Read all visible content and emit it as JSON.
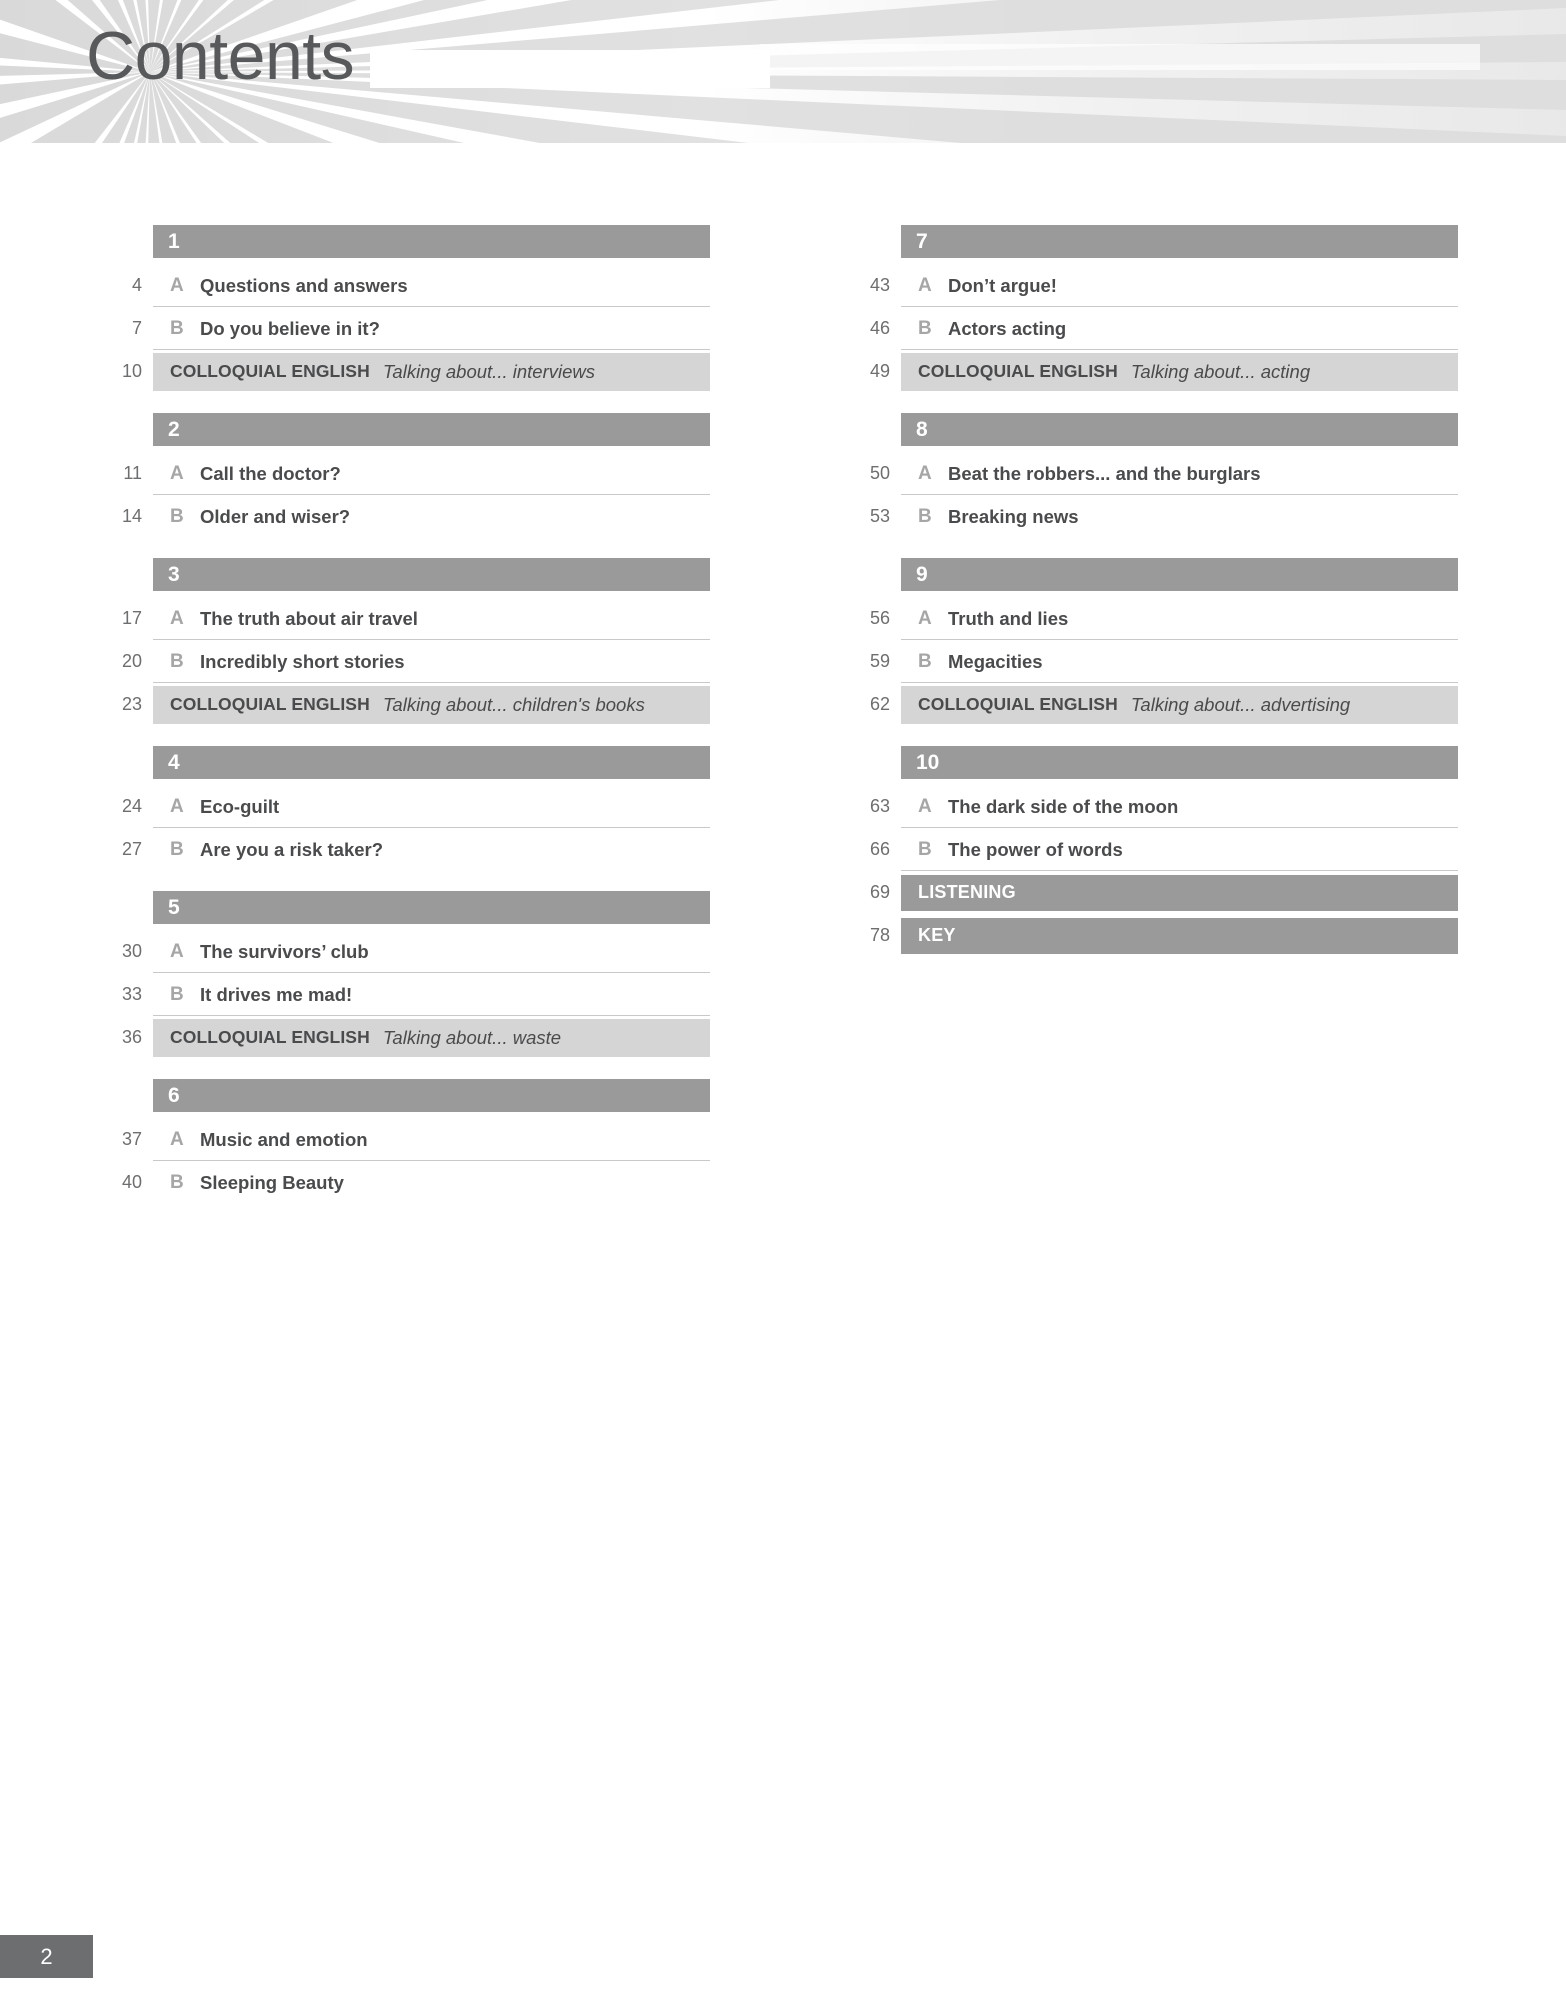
{
  "header": {
    "title": "Contents"
  },
  "footer": {
    "page_number": "2"
  },
  "labels": {
    "colloquial_english": "COLLOQUIAL ENGLISH"
  },
  "columns": {
    "left": [
      {
        "unit": "1",
        "entries": [
          {
            "kind": "lesson",
            "page": "4",
            "letter": "A",
            "title": "Questions and answers"
          },
          {
            "kind": "lesson",
            "page": "7",
            "letter": "B",
            "title": "Do you believe in it?"
          },
          {
            "kind": "colloquial",
            "page": "10",
            "label": "COLLOQUIAL ENGLISH",
            "topic": "Talking about... interviews"
          }
        ]
      },
      {
        "unit": "2",
        "entries": [
          {
            "kind": "lesson",
            "page": "11",
            "letter": "A",
            "title": "Call the doctor?"
          },
          {
            "kind": "lesson",
            "page": "14",
            "letter": "B",
            "title": "Older and wiser?"
          }
        ]
      },
      {
        "unit": "3",
        "entries": [
          {
            "kind": "lesson",
            "page": "17",
            "letter": "A",
            "title": "The truth about air travel"
          },
          {
            "kind": "lesson",
            "page": "20",
            "letter": "B",
            "title": "Incredibly short stories"
          },
          {
            "kind": "colloquial",
            "page": "23",
            "label": "COLLOQUIAL ENGLISH",
            "topic": "Talking about... children's books"
          }
        ]
      },
      {
        "unit": "4",
        "entries": [
          {
            "kind": "lesson",
            "page": "24",
            "letter": "A",
            "title": "Eco-guilt"
          },
          {
            "kind": "lesson",
            "page": "27",
            "letter": "B",
            "title": "Are you a risk taker?"
          }
        ]
      },
      {
        "unit": "5",
        "entries": [
          {
            "kind": "lesson",
            "page": "30",
            "letter": "A",
            "title": "The survivors’ club"
          },
          {
            "kind": "lesson",
            "page": "33",
            "letter": "B",
            "title": "It drives me mad!"
          },
          {
            "kind": "colloquial",
            "page": "36",
            "label": "COLLOQUIAL ENGLISH",
            "topic": "Talking about... waste"
          }
        ]
      },
      {
        "unit": "6",
        "entries": [
          {
            "kind": "lesson",
            "page": "37",
            "letter": "A",
            "title": "Music and emotion"
          },
          {
            "kind": "lesson",
            "page": "40",
            "letter": "B",
            "title": "Sleeping Beauty"
          }
        ]
      }
    ],
    "right": [
      {
        "unit": "7",
        "entries": [
          {
            "kind": "lesson",
            "page": "43",
            "letter": "A",
            "title": "Don’t argue!"
          },
          {
            "kind": "lesson",
            "page": "46",
            "letter": "B",
            "title": "Actors acting"
          },
          {
            "kind": "colloquial",
            "page": "49",
            "label": "COLLOQUIAL ENGLISH",
            "topic": "Talking about... acting"
          }
        ]
      },
      {
        "unit": "8",
        "entries": [
          {
            "kind": "lesson",
            "page": "50",
            "letter": "A",
            "title": "Beat the robbers... and the burglars"
          },
          {
            "kind": "lesson",
            "page": "53",
            "letter": "B",
            "title": "Breaking news"
          }
        ]
      },
      {
        "unit": "9",
        "entries": [
          {
            "kind": "lesson",
            "page": "56",
            "letter": "A",
            "title": "Truth and lies"
          },
          {
            "kind": "lesson",
            "page": "59",
            "letter": "B",
            "title": "Megacities"
          },
          {
            "kind": "colloquial",
            "page": "62",
            "label": "COLLOQUIAL ENGLISH",
            "topic": "Talking about... advertising"
          }
        ]
      },
      {
        "unit": "10",
        "entries": [
          {
            "kind": "lesson",
            "page": "63",
            "letter": "A",
            "title": "The dark side of the moon"
          },
          {
            "kind": "lesson",
            "page": "66",
            "letter": "B",
            "title": "The power of words"
          },
          {
            "kind": "section",
            "page": "69",
            "label": "LISTENING"
          },
          {
            "kind": "section",
            "page": "78",
            "label": "KEY"
          }
        ]
      }
    ]
  },
  "colors": {
    "unit_bar": "#9a9a9a",
    "colloquial_bg": "#d5d5d5",
    "title_text": "#58595b",
    "banner_bg": "#d9d9d9",
    "page_badge": "#6d6e70"
  }
}
